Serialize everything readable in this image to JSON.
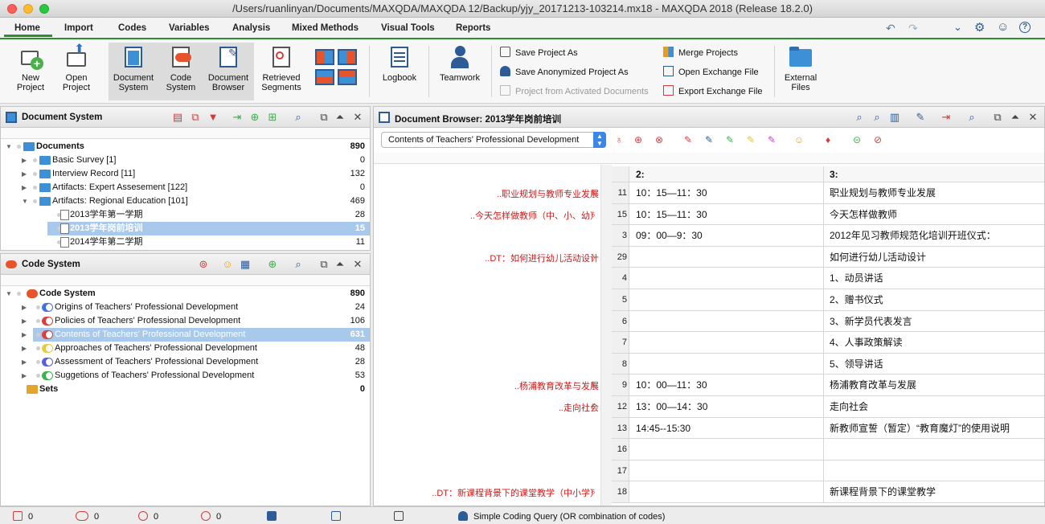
{
  "window": {
    "title": "/Users/ruanlinyan/Documents/MAXQDA/MAXQDA 12/Backup/yjy_20171213-103214.mx18 - MAXQDA 2018 (Release 18.2.0)"
  },
  "menu_tabs": [
    "Home",
    "Import",
    "Codes",
    "Variables",
    "Analysis",
    "Mixed Methods",
    "Visual Tools",
    "Reports"
  ],
  "ribbon": {
    "new_project": "New\nProject",
    "open_project": "Open\nProject",
    "document_system": "Document\nSystem",
    "code_system": "Code\nSystem",
    "document_browser": "Document\nBrowser",
    "retrieved_segments": "Retrieved\nSegments",
    "logbook": "Logbook",
    "teamwork": "Teamwork",
    "save_project_as": "Save Project As",
    "save_anonymized": "Save Anonymized Project As",
    "project_from_activated": "Project from Activated Documents",
    "merge_projects": "Merge Projects",
    "open_exchange": "Open Exchange File",
    "export_exchange": "Export Exchange File",
    "external_files": "External\nFiles"
  },
  "document_system": {
    "title": "Document System",
    "rows": [
      {
        "label": "Documents",
        "count": "890",
        "level": 0,
        "type": "root"
      },
      {
        "label": "Basic Survey [1]",
        "count": "0",
        "level": 1,
        "type": "folder"
      },
      {
        "label": "Interview Record [11]",
        "count": "132",
        "level": 1,
        "type": "folder"
      },
      {
        "label": "Artifacts: Expert Assesement [122]",
        "count": "0",
        "level": 1,
        "type": "folder"
      },
      {
        "label": "Artifacts: Regional Education [101]",
        "count": "469",
        "level": 1,
        "type": "folder",
        "open": true
      },
      {
        "label": "2013学年第一学期",
        "count": "28",
        "level": 2,
        "type": "doc"
      },
      {
        "label": "2013学年岗前培训",
        "count": "15",
        "level": 2,
        "type": "doc",
        "selected": true
      },
      {
        "label": "2014学年第二学期",
        "count": "11",
        "level": 2,
        "type": "doc"
      }
    ]
  },
  "code_system": {
    "title": "Code System",
    "rows": [
      {
        "label": "Code System",
        "count": "890",
        "level": 0,
        "type": "root"
      },
      {
        "label": "Origins of Teachers' Professional Development",
        "count": "24",
        "color": "#3b6fd8"
      },
      {
        "label": "Policies of Teachers' Professional Development",
        "count": "106",
        "color": "#d83b3b"
      },
      {
        "label": "Contents of Teachers' Professional Development",
        "count": "631",
        "color": "#d83b3b",
        "selected": true
      },
      {
        "label": "Approaches of Teachers' Professional Development",
        "count": "48",
        "color": "#e7c93b"
      },
      {
        "label": "Assessment of Teachers' Professional Development",
        "count": "28",
        "color": "#5a5ad8"
      },
      {
        "label": "Suggetions of Teachers' Professional Development",
        "count": "53",
        "color": "#3bb04a"
      },
      {
        "label": "Sets",
        "count": "0",
        "type": "sets"
      }
    ]
  },
  "document_browser": {
    "title": "Document Browser: 2013学年岗前培训",
    "code_dropdown": "Contents of Teachers' Professional Development",
    "col2": "2:",
    "col3": "3:",
    "rows": [
      {
        "n": "11",
        "c2": "10：15—11：30",
        "c3": "职业规划与教师专业发展",
        "memo": "..职业规划与教师专业发展"
      },
      {
        "n": "15",
        "c2": "10：15—11：30",
        "c3": "今天怎样做教师",
        "memo": "..今天怎样做教师（中、小、幼）"
      },
      {
        "n": "3",
        "c2": "09：00—9：30",
        "c3": "2012年见习教师规范化培训开班仪式：",
        "memo": ""
      },
      {
        "n": "29",
        "c2": "",
        "c3": "如何进行幼儿活动设计",
        "memo": "..DT：如何进行幼儿活动设计"
      },
      {
        "n": "4",
        "c2": "",
        "c3": "1、动员讲话",
        "memo": ""
      },
      {
        "n": "5",
        "c2": "",
        "c3": "2、赠书仪式",
        "memo": ""
      },
      {
        "n": "6",
        "c2": "",
        "c3": "3、新学员代表发言",
        "memo": ""
      },
      {
        "n": "7",
        "c2": "",
        "c3": "4、人事政策解读",
        "memo": ""
      },
      {
        "n": "8",
        "c2": "",
        "c3": "5、领导讲话",
        "memo": ""
      },
      {
        "n": "9",
        "c2": "10：00—11：30",
        "c3": "杨浦教育改革与发展",
        "memo": "..杨浦教育改革与发展"
      },
      {
        "n": "12",
        "c2": "13：00—14：30",
        "c3": "走向社会",
        "memo": "..走向社会"
      },
      {
        "n": "13",
        "c2": "14:45--15:30",
        "c3": "新教师宣誓（暂定）“教育魔灯”的使用说明",
        "memo": ""
      },
      {
        "n": "16",
        "c2": "",
        "c3": "",
        "memo": ""
      },
      {
        "n": "17",
        "c2": "",
        "c3": "",
        "memo": ""
      },
      {
        "n": "18",
        "c2": "",
        "c3": "新课程背景下的课堂教学",
        "memo": "..DT：新课程背景下的课堂教学（中小学）"
      }
    ]
  },
  "status_bar": {
    "c1": "0",
    "c2": "0",
    "c3": "0",
    "c4": "0",
    "query": "Simple Coding Query (OR combination of codes)"
  }
}
